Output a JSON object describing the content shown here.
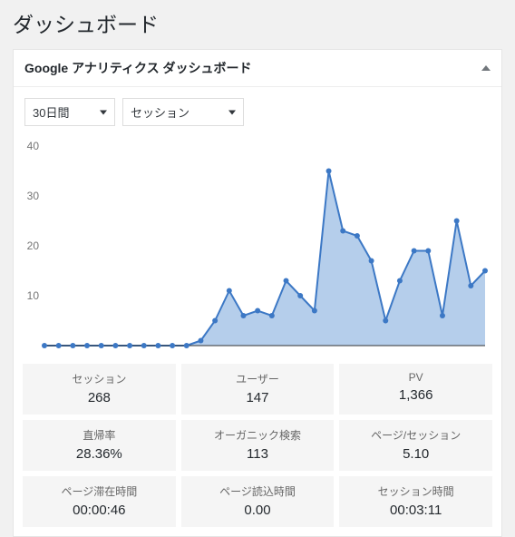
{
  "page_title": "ダッシュボード",
  "panel": {
    "title": "Google アナリティクス ダッシュボード",
    "collapse_icon": "triangle-up"
  },
  "controls": {
    "period": {
      "selected": "30日間"
    },
    "metric": {
      "selected": "セッション"
    }
  },
  "chart_data": {
    "type": "area",
    "ylabel": "",
    "ylim": [
      0,
      40
    ],
    "yticks": [
      10,
      20,
      30,
      40
    ],
    "x": [
      1,
      2,
      3,
      4,
      5,
      6,
      7,
      8,
      9,
      10,
      11,
      12,
      13,
      14,
      15,
      16,
      17,
      18,
      19,
      20,
      21,
      22,
      23,
      24,
      25,
      26,
      27,
      28,
      29,
      30
    ],
    "series": [
      {
        "name": "セッション",
        "values": [
          0,
          0,
          0,
          0,
          0,
          0,
          0,
          0,
          0,
          0,
          0,
          1,
          5,
          11,
          6,
          7,
          6,
          13,
          10,
          7,
          35,
          23,
          22,
          17,
          5,
          13,
          19,
          19,
          6,
          25,
          12,
          15
        ]
      }
    ]
  },
  "stats": [
    {
      "label": "セッション",
      "value": "268"
    },
    {
      "label": "ユーザー",
      "value": "147"
    },
    {
      "label": "PV",
      "value": "1,366"
    },
    {
      "label": "直帰率",
      "value": "28.36%"
    },
    {
      "label": "オーガニック検索",
      "value": "113"
    },
    {
      "label": "ページ/セッション",
      "value": "5.10"
    },
    {
      "label": "ページ滞在時間",
      "value": "00:00:46"
    },
    {
      "label": "ページ読込時間",
      "value": "0.00"
    },
    {
      "label": "セッション時間",
      "value": "00:03:11"
    }
  ]
}
